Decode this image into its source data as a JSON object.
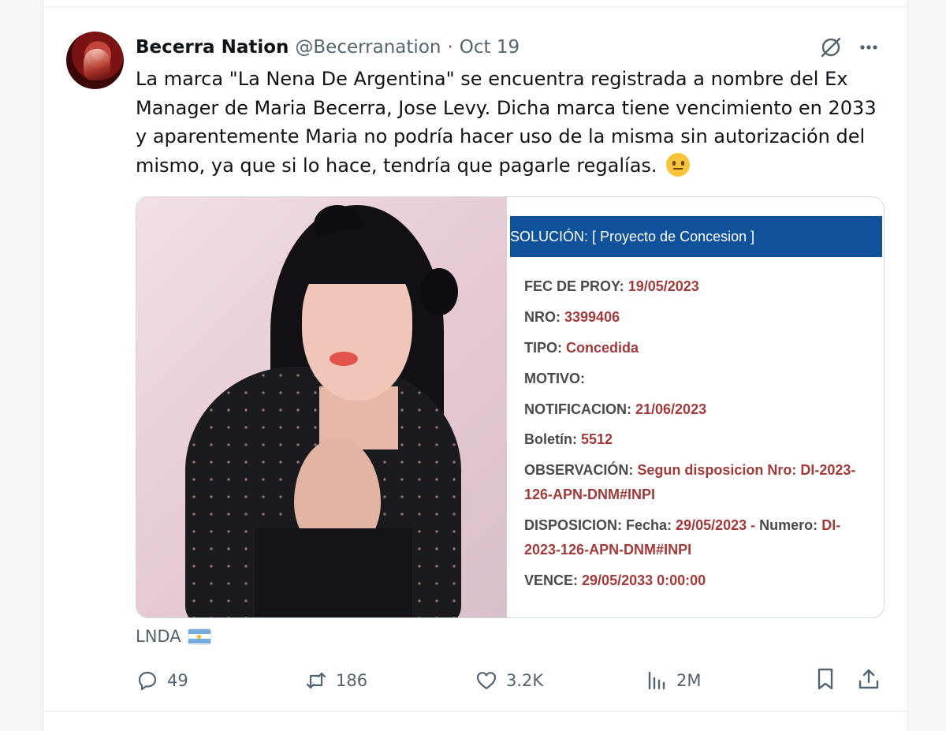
{
  "tweet": {
    "author_name": "Becerra Nation",
    "author_handle": "@Becerranation",
    "separator": "·",
    "date": "Oct 19",
    "text": "La marca \"La Nena De Argentina\" se encuentra registrada a nombre del Ex Manager de Maria Becerra, Jose Levy. Dicha marca tiene vencimiento en 2033 y aparentemente Maria no podría hacer uso de la misma sin autorización del mismo, ya que si lo hace, tendría que pagarle regalías.",
    "emoji_icon": "neutral-face-icon",
    "caption": "LNDA",
    "caption_flag_icon": "argentina-flag-icon"
  },
  "document": {
    "banner": "SOLUCIÓN: [ Proyecto de Concesion ]",
    "fec_label": "FEC DE PROY:",
    "fec_value": "19/05/2023",
    "nro_label": "NRO:",
    "nro_value": "3399406",
    "tipo_label": "TIPO:",
    "tipo_value": "Concedida",
    "motivo_label": "MOTIVO:",
    "notif_label": "NOTIFICACION:",
    "notif_value": "21/06/2023",
    "boletin_label": "Boletín:",
    "boletin_value": "5512",
    "obs_label": "OBSERVACIÓN:",
    "obs_value_1": "Segun disposicion Nro: DI-2023-",
    "obs_value_2": "126-APN-DNM#INPI",
    "disp_label": "DISPOSICION: Fecha:",
    "disp_fecha": "29/05/2023",
    "disp_sep": "-",
    "disp_numero_label": "Numero:",
    "disp_numero_1": "DI-",
    "disp_numero_2": "2023-126-APN-DNM#INPI",
    "vence_label": "VENCE:",
    "vence_value": "29/05/2033 0:00:00"
  },
  "actions": {
    "replies": "49",
    "reposts": "186",
    "likes": "3.2K",
    "views": "2M"
  },
  "colors": {
    "banner_blue": "#0f519a",
    "doc_value_red": "#a33a3a",
    "muted_text": "#536471"
  }
}
